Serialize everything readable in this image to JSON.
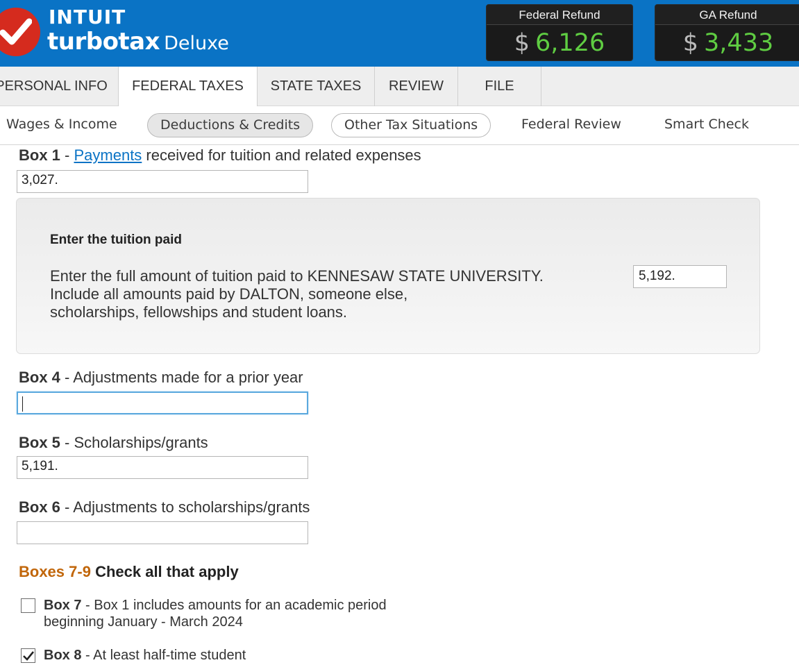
{
  "header": {
    "brand_company": "INTUIT",
    "brand_product": "turbotax",
    "brand_edition": "Deluxe",
    "federal_refund": {
      "label": "Federal Refund",
      "currency": "$",
      "amount": "6,126"
    },
    "state_refund": {
      "label": "GA Refund",
      "currency": "$",
      "amount": "3,433"
    },
    "colors": {
      "header_bg": "#0a73c5",
      "refund_amount": "#5fcd42",
      "logo_red": "#d52b1e"
    }
  },
  "main_tabs": [
    {
      "label": "PERSONAL INFO",
      "active": false
    },
    {
      "label": "FEDERAL TAXES",
      "active": true
    },
    {
      "label": "STATE TAXES",
      "active": false
    },
    {
      "label": "REVIEW",
      "active": false
    },
    {
      "label": "FILE",
      "active": false
    }
  ],
  "sub_nav": [
    {
      "label": "Wages & Income"
    },
    {
      "label": "Deductions & Credits",
      "current": true
    },
    {
      "label": "Other Tax Situations"
    },
    {
      "label": "Federal Review"
    },
    {
      "label": "Smart Check"
    }
  ],
  "form": {
    "box1": {
      "box": "Box 1",
      "sep": " - ",
      "link": "Payments",
      "text": " received for tuition and related expenses",
      "value": "3,027."
    },
    "tuition_panel": {
      "title": "Enter the tuition paid",
      "line1": "Enter the full amount of tuition paid to KENNESAW STATE UNIVERSITY.",
      "line2": "Include all amounts paid by DALTON, someone else,",
      "line3": "scholarships, fellowships and student loans.",
      "value": "5,192."
    },
    "box4": {
      "box": "Box 4",
      "text": " - Adjustments made for a prior year",
      "value": ""
    },
    "box5": {
      "box": "Box 5",
      "text": " - Scholarships/grants",
      "value": "5,191."
    },
    "box6": {
      "box": "Box 6",
      "text": " - Adjustments to scholarships/grants",
      "value": ""
    },
    "boxes79": {
      "range": "Boxes 7-9",
      "text": " Check all that apply"
    },
    "box7": {
      "box": "Box 7",
      "line1": " - Box 1 includes amounts for an academic period",
      "line2": "beginning January - March 2024",
      "checked": false
    },
    "box8": {
      "box": "Box 8",
      "text": " - At least half-time student",
      "checked": true
    }
  }
}
